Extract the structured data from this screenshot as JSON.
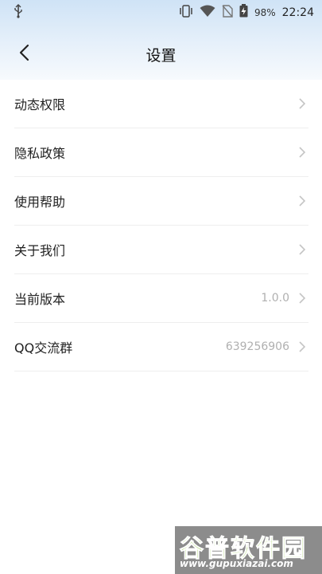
{
  "status_bar": {
    "battery_percent": "98%",
    "time": "22:24",
    "icons": [
      "usb-icon",
      "vibrate-icon",
      "wifi-icon",
      "no-sim-icon",
      "battery-charging-icon"
    ]
  },
  "header": {
    "title": "设置",
    "back_icon": "chevron-left-icon"
  },
  "settings": {
    "items": [
      {
        "label": "动态权限",
        "value": ""
      },
      {
        "label": "隐私政策",
        "value": ""
      },
      {
        "label": "使用帮助",
        "value": ""
      },
      {
        "label": "关于我们",
        "value": ""
      },
      {
        "label": "当前版本",
        "value": "1.0.0"
      },
      {
        "label": "QQ交流群",
        "value": "639256906"
      }
    ]
  },
  "watermark": {
    "logo_text": "谷普软件园",
    "url": "www.gupuxiazai.com"
  },
  "colors": {
    "header_gradient_top": "#cfe3f6",
    "divider": "#eeeeee",
    "value_text": "#b0b0b0",
    "watermark_green": "#8ec63f"
  }
}
